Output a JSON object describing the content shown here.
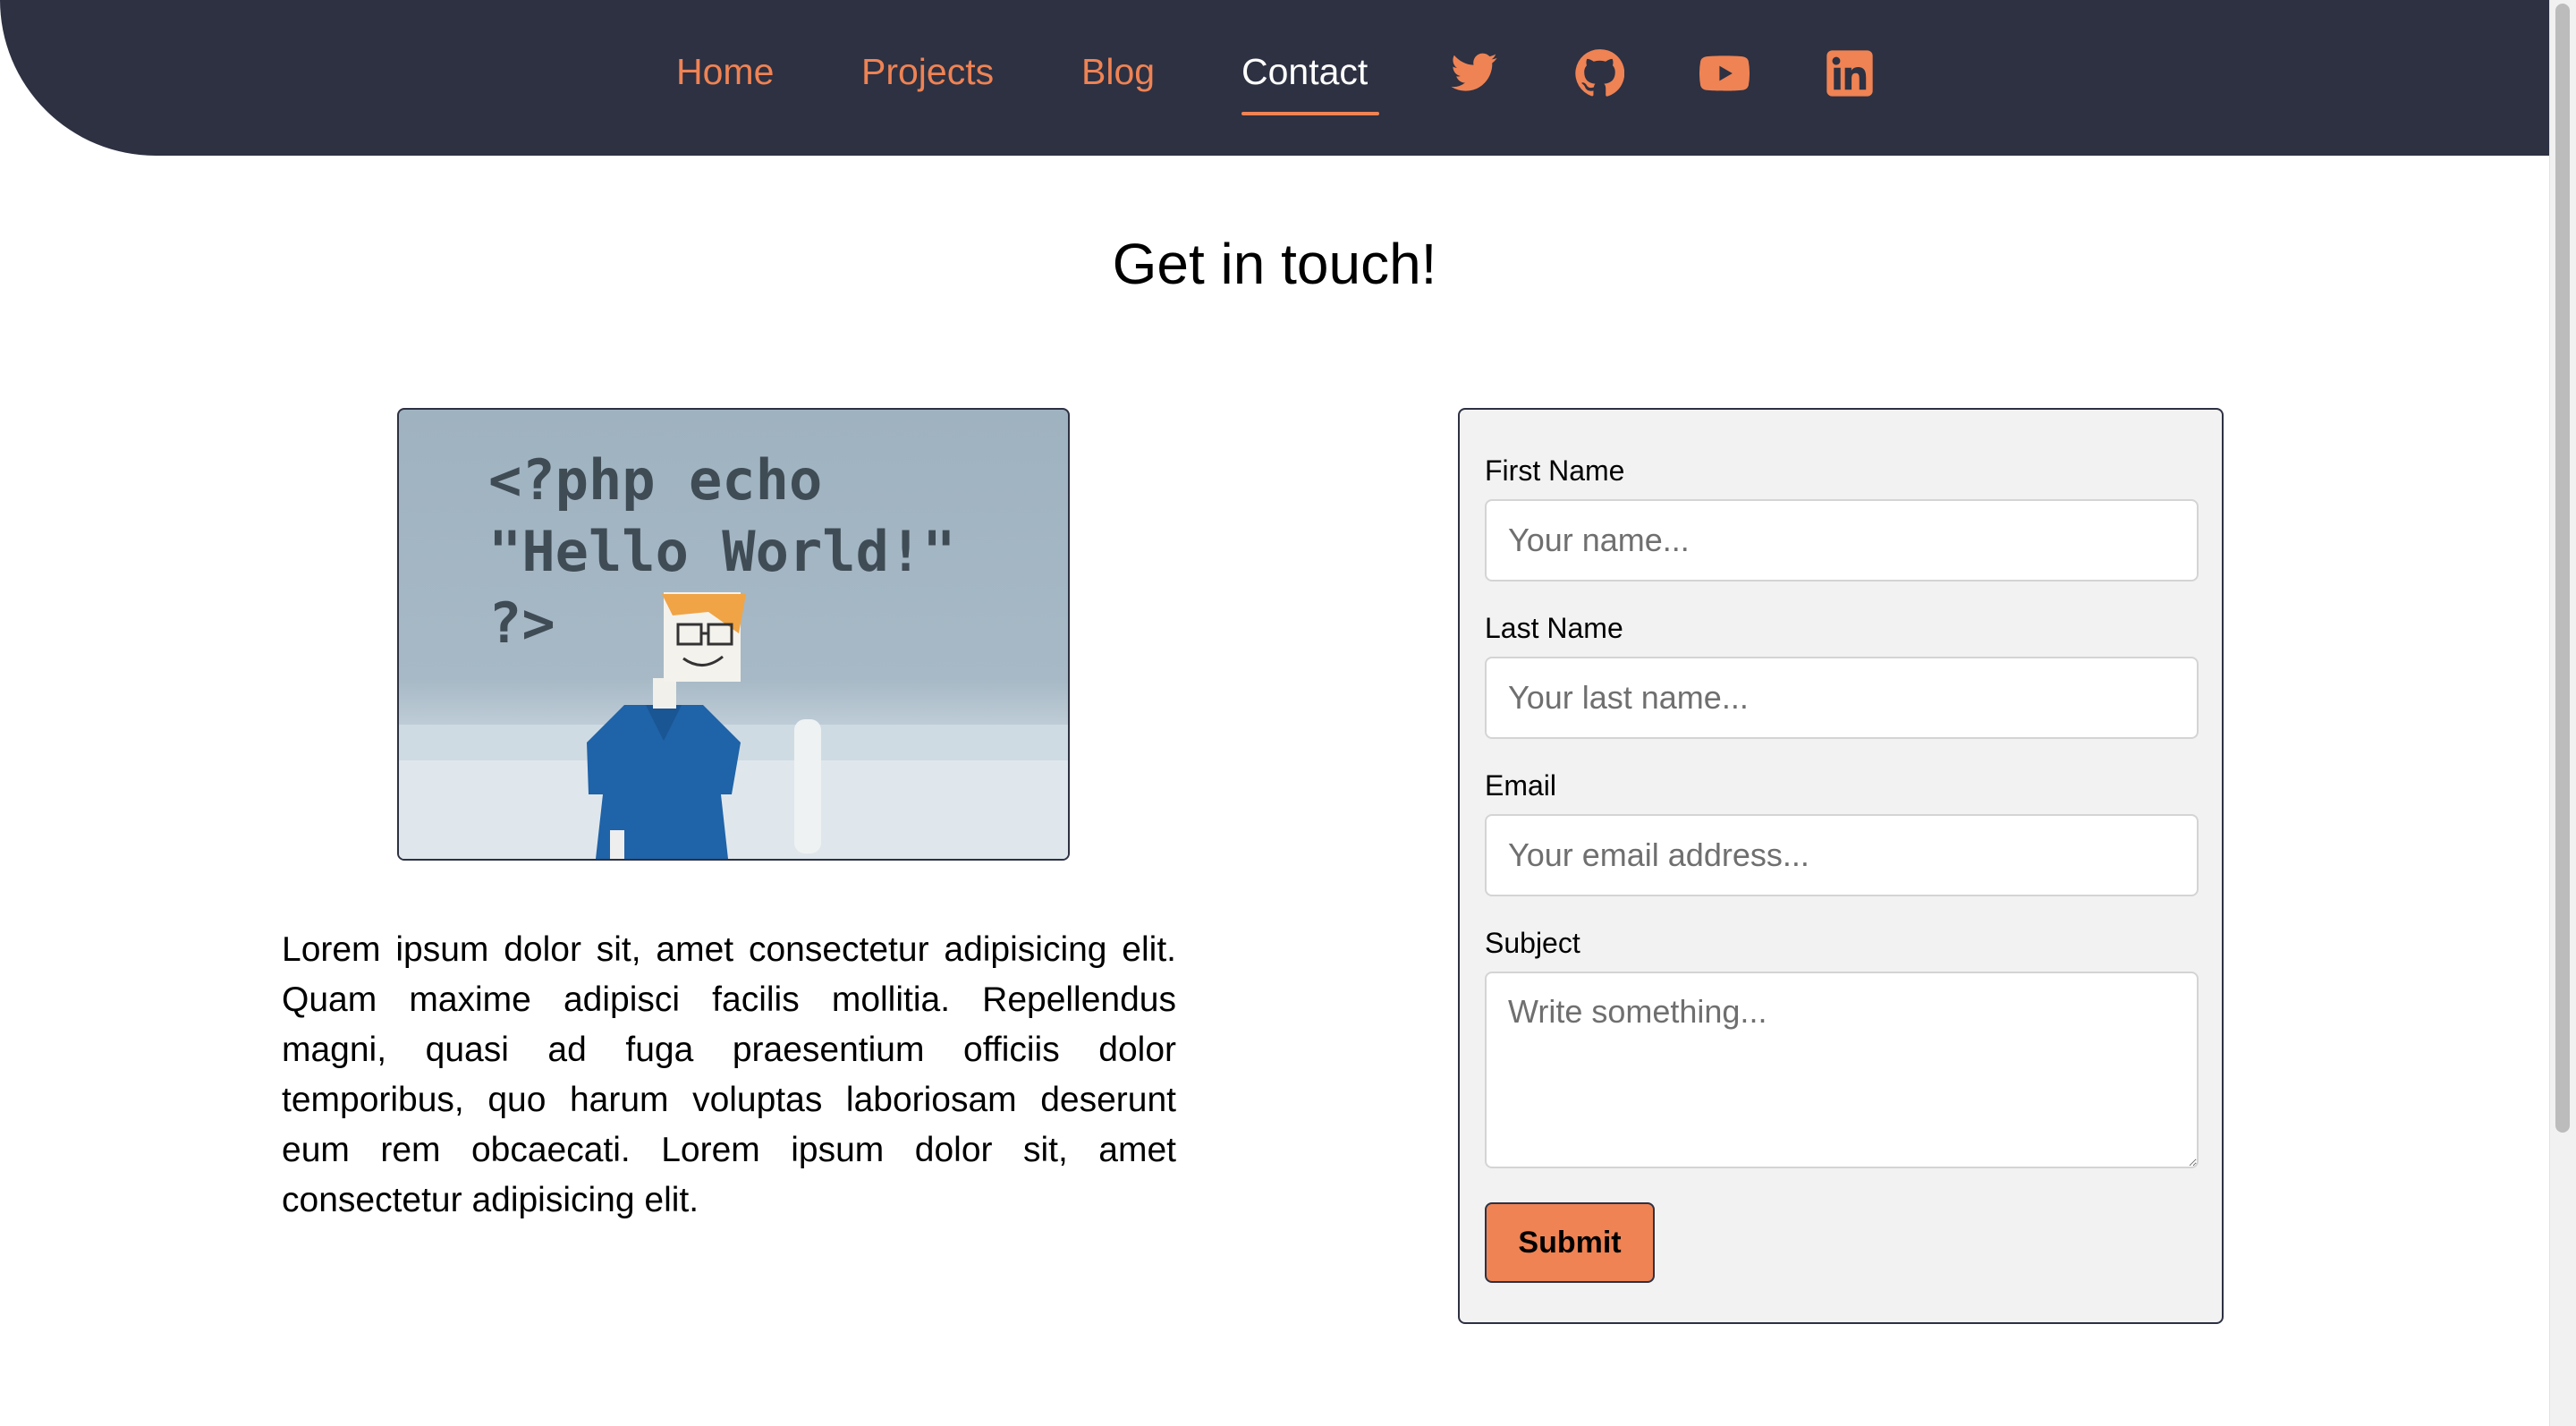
{
  "nav": {
    "links": [
      {
        "label": "Home"
      },
      {
        "label": "Projects"
      },
      {
        "label": "Blog"
      },
      {
        "label": "Contact",
        "active": true
      }
    ],
    "social_icons": [
      "twitter-icon",
      "github-icon",
      "youtube-icon",
      "linkedin-icon"
    ],
    "accent_color": "#ef8354",
    "background_color": "#2d3142"
  },
  "page": {
    "title": "Get in touch!"
  },
  "hero_image": {
    "code_lines": [
      "<?php echo",
      "\"Hello World!\"",
      "?>"
    ]
  },
  "intro_text": "Lorem ipsum dolor sit, amet consectetur adipisicing elit. Quam maxime adipisci facilis mollitia. Repellendus magni, quasi ad fuga praesentium officiis dolor temporibus, quo harum voluptas laboriosam deserunt eum rem obcaecati. Lorem ipsum dolor sit, amet consectetur adipisicing elit.",
  "form": {
    "first_name": {
      "label": "First Name",
      "placeholder": "Your name...",
      "value": ""
    },
    "last_name": {
      "label": "Last Name",
      "placeholder": "Your last name...",
      "value": ""
    },
    "email": {
      "label": "Email",
      "placeholder": "Your email address...",
      "value": ""
    },
    "subject": {
      "label": "Subject",
      "placeholder": "Write something...",
      "value": ""
    },
    "submit_label": "Submit"
  }
}
